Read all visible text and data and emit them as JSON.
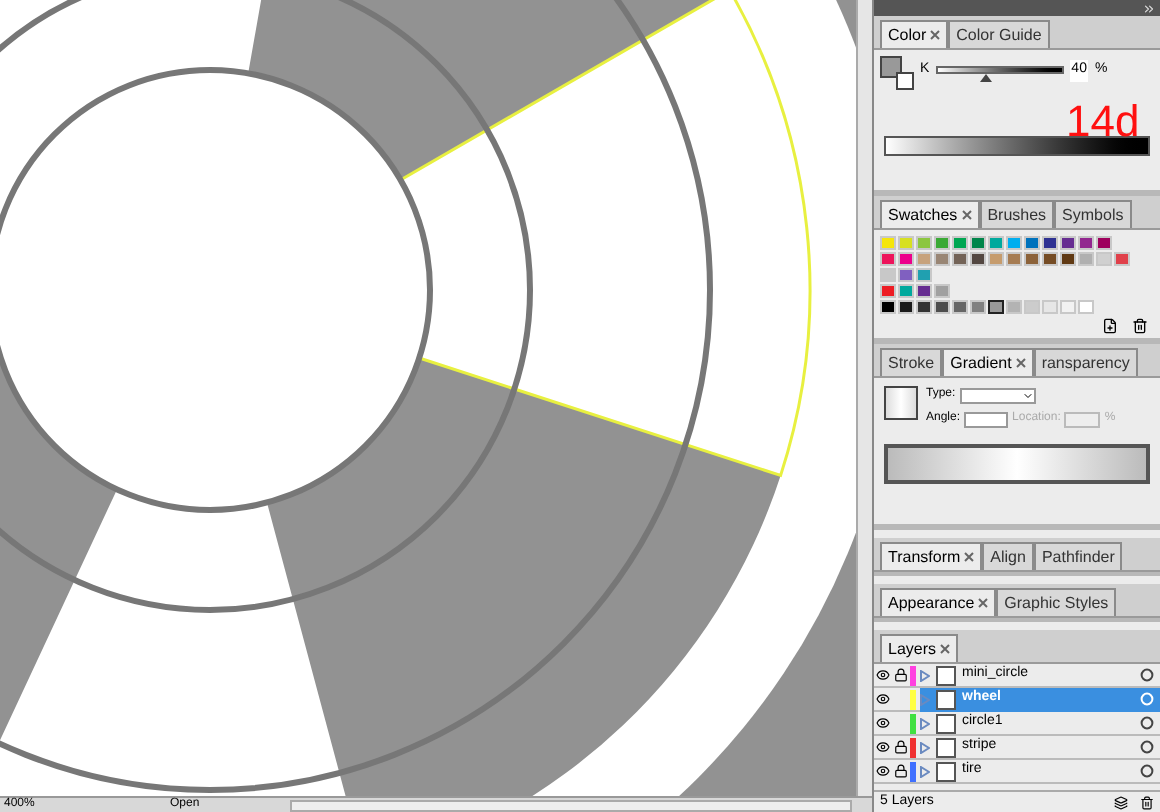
{
  "annotation": "14d",
  "color_panel": {
    "tabs": [
      {
        "label": "Color",
        "selected": true
      },
      {
        "label": "Color Guide",
        "selected": false
      }
    ],
    "channel": "K",
    "level": 0.4,
    "value": "40",
    "unit": "%"
  },
  "swatches_panel": {
    "tabs": [
      {
        "label": "Swatches",
        "selected": true
      },
      {
        "label": "Brushes",
        "selected": false
      },
      {
        "label": "Symbols",
        "selected": false
      }
    ],
    "rows": [
      [
        {
          "color": "#f5e60a",
          "selected": false
        },
        {
          "color": "#d7e021",
          "selected": false
        },
        {
          "color": "#8cc63f",
          "selected": false
        },
        {
          "color": "#3aa935",
          "selected": false
        },
        {
          "color": "#00a651",
          "selected": false
        },
        {
          "color": "#00854a",
          "selected": false
        },
        {
          "color": "#00a99d",
          "selected": false
        },
        {
          "color": "#00aeef",
          "selected": false
        },
        {
          "color": "#0072bc",
          "selected": false
        },
        {
          "color": "#2e3192",
          "selected": false
        },
        {
          "color": "#662d91",
          "selected": false
        },
        {
          "color": "#92278f",
          "selected": false
        },
        {
          "color": "#9e005d",
          "selected": false
        }
      ],
      [
        {
          "color": "#ed145b",
          "selected": false
        },
        {
          "color": "#ec008c",
          "selected": false
        },
        {
          "color": "#c7a27c",
          "selected": false
        },
        {
          "color": "#998675",
          "selected": false
        },
        {
          "color": "#736357",
          "selected": false
        },
        {
          "color": "#534741",
          "selected": false
        },
        {
          "color": "#c69c6d",
          "selected": false
        },
        {
          "color": "#a67c52",
          "selected": false
        },
        {
          "color": "#8c6239",
          "selected": false
        },
        {
          "color": "#754c24",
          "selected": false
        },
        {
          "color": "#603913",
          "selected": false
        },
        {
          "color": "#b0b0b0",
          "selected": false
        },
        {
          "color": "#d0d0d0",
          "selected": false
        },
        {
          "color": "#e0404a",
          "selected": false
        }
      ],
      [
        {
          "color": "#c8c8c8",
          "selected": false
        },
        {
          "color": "#8060c0",
          "selected": false
        },
        {
          "color": "#20a0b0",
          "selected": false
        }
      ],
      [
        {
          "color": "#ed1c24",
          "selected": false
        },
        {
          "color": "#00a99d",
          "selected": false
        },
        {
          "color": "#662d91",
          "selected": false
        },
        {
          "color": "#a0a0a0",
          "selected": false
        }
      ],
      [
        {
          "color": "#000000",
          "selected": false
        },
        {
          "color": "#1a1a1a",
          "selected": false
        },
        {
          "color": "#333333",
          "selected": false
        },
        {
          "color": "#4d4d4d",
          "selected": false
        },
        {
          "color": "#666666",
          "selected": false
        },
        {
          "color": "#808080",
          "selected": false
        },
        {
          "color": "#999999",
          "selected": true
        },
        {
          "color": "#b3b3b3",
          "selected": false
        },
        {
          "color": "#cccccc",
          "selected": false
        },
        {
          "color": "#e6e6e6",
          "selected": false
        },
        {
          "color": "#f2f2f2",
          "selected": false
        },
        {
          "color": "#ffffff",
          "selected": false
        }
      ]
    ]
  },
  "gradient_panel": {
    "tabs": [
      {
        "label": "Stroke",
        "selected": false
      },
      {
        "label": "Gradient",
        "selected": true
      },
      {
        "label": "ransparency",
        "selected": false
      }
    ],
    "type_label": "Type:",
    "angle_label": "Angle:",
    "location_label": "Location:",
    "location_disabled": true,
    "unit": "%"
  },
  "transform_panel": {
    "tabs": [
      {
        "label": "Transform",
        "selected": true
      },
      {
        "label": "Align",
        "selected": false
      },
      {
        "label": "Pathfinder",
        "selected": false
      }
    ]
  },
  "appearance_panel": {
    "tabs": [
      {
        "label": "Appearance",
        "selected": true
      },
      {
        "label": "Graphic Styles",
        "selected": false
      }
    ]
  },
  "layers_panel": {
    "tabs": [
      {
        "label": "Layers",
        "selected": true
      }
    ],
    "layers": [
      {
        "name": "mini_circle",
        "visible": true,
        "locked": true,
        "color": "#ff40e0",
        "selected": false
      },
      {
        "name": "wheel",
        "visible": true,
        "locked": false,
        "color": "#ffff40",
        "selected": true
      },
      {
        "name": "circle1",
        "visible": true,
        "locked": false,
        "color": "#40e040",
        "selected": false
      },
      {
        "name": "stripe",
        "visible": true,
        "locked": true,
        "color": "#f03030",
        "selected": false
      },
      {
        "name": "tire",
        "visible": true,
        "locked": true,
        "color": "#4070ff",
        "selected": false
      }
    ],
    "footer": "5 Layers"
  },
  "status_bar": {
    "zoom": "400%",
    "status": "Open"
  }
}
